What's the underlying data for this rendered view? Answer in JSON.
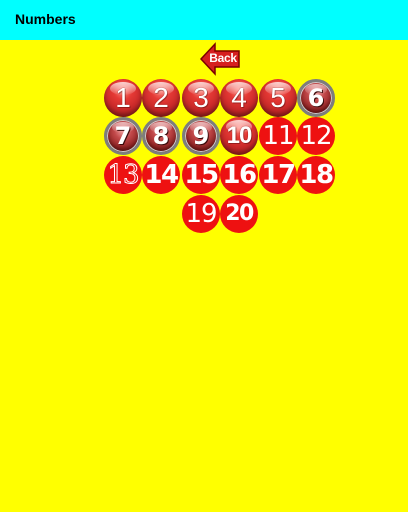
{
  "app_bar": {
    "title": "Numbers",
    "color": "#00FFFF"
  },
  "background_color": "#FFFF00",
  "back_button": {
    "label": "Back",
    "icon": "left-arrow-icon"
  },
  "numbers": [
    "1",
    "2",
    "3",
    "4",
    "5",
    "6",
    "7",
    "8",
    "9",
    "10",
    "11",
    "12",
    "13",
    "14",
    "15",
    "16",
    "17",
    "18",
    "19",
    "20"
  ]
}
